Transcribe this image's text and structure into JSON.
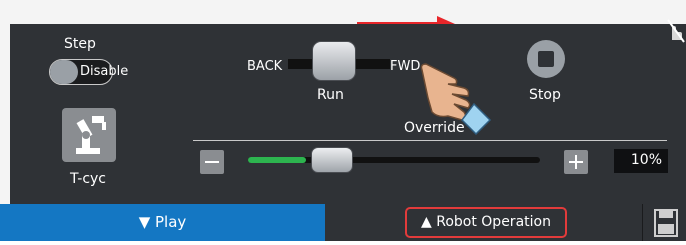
{
  "step": {
    "label": "Step",
    "toggle_value": "Disable"
  },
  "tcyc": {
    "label": "T-cyc"
  },
  "run_control": {
    "back_label": "BACK",
    "fwd_label": "FWD",
    "run_label": "Run"
  },
  "stop": {
    "label": "Stop"
  },
  "override": {
    "label": "Override",
    "value_text": "10%",
    "value": 0.1
  },
  "bottom_bar": {
    "play_label": "▼ Play",
    "robot_operation_label": "▲ Robot Operation"
  },
  "colors": {
    "panel": "#2f3236",
    "accent_blue": "#1477c3",
    "slider_green": "#2db44f",
    "highlight_red": "#e23b3b"
  },
  "icons": [
    "arrow-right-icon",
    "no-touch-icon",
    "robot-arm-icon",
    "stop-icon",
    "minus-icon",
    "plus-icon",
    "hand-pointer-icon",
    "save-icon"
  ]
}
